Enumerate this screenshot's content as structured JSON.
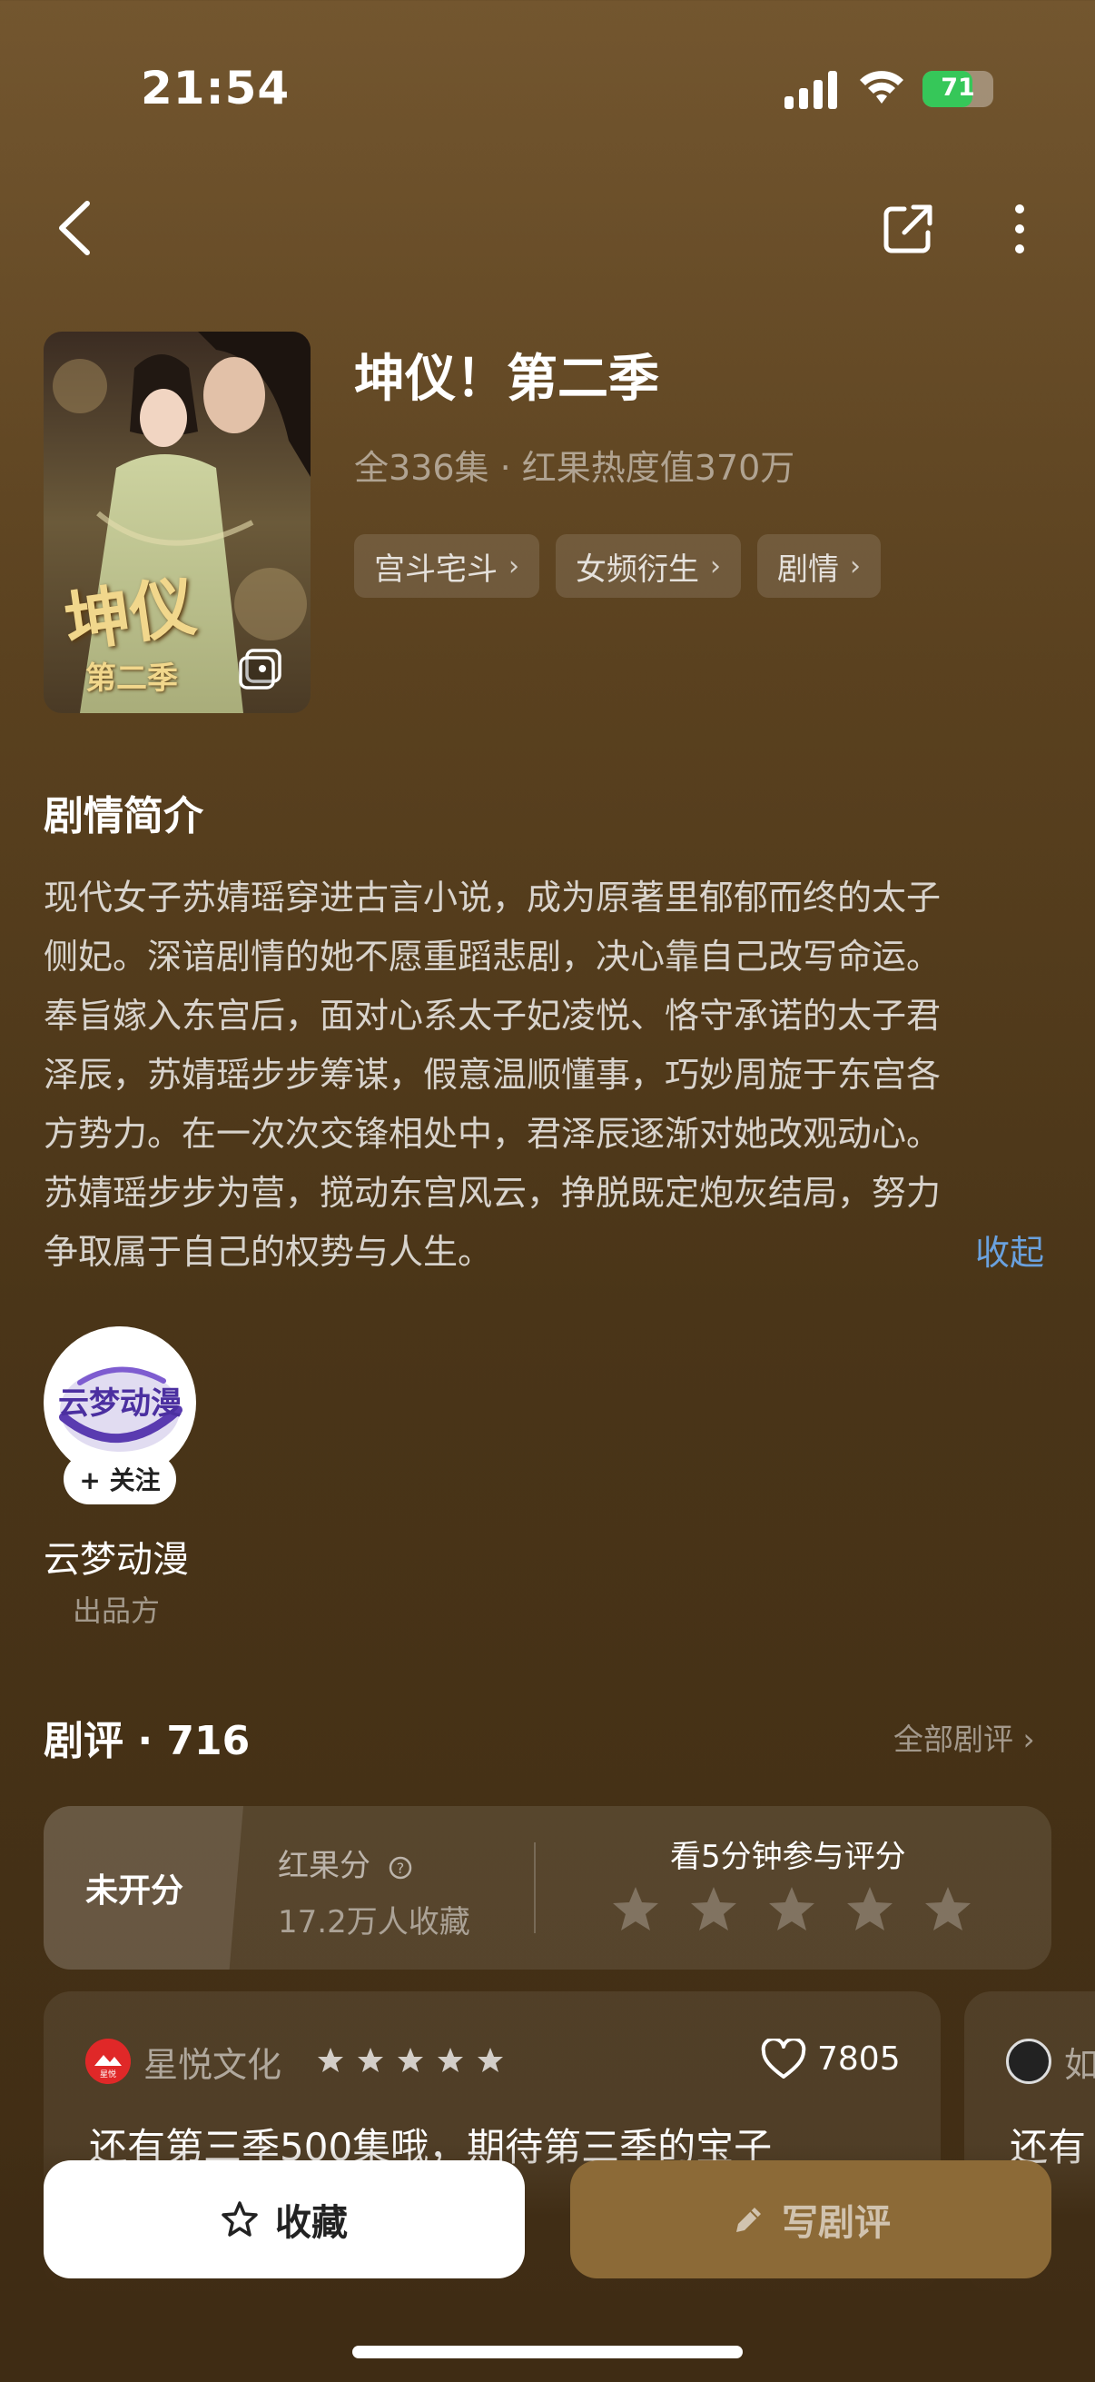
{
  "status_bar": {
    "time": "21:54",
    "battery": "71",
    "battery_level": 0.71
  },
  "show": {
    "title": "坤仪！第二季",
    "meta": "全336集 · 红果热度值370万",
    "tags": [
      "宫斗宅斗",
      "女频衍生",
      "剧情"
    ],
    "cover_title": "坤仪",
    "cover_subtitle": "第二季"
  },
  "synopsis": {
    "heading": "剧情简介",
    "lines": [
      "现代女子苏婧瑶穿进古言小说，成为原著里郁郁而终的太子",
      "侧妃。深谙剧情的她不愿重蹈悲剧，决心靠自己改写命运。",
      "奉旨嫁入东宫后，面对心系太子妃凌悦、恪守承诺的太子君",
      "泽辰，苏婧瑶步步筹谋，假意温顺懂事，巧妙周旋于东宫各",
      "方势力。在一次次交锋相处中，君泽辰逐渐对她改观动心。",
      "苏婧瑶步步为营，搅动东宫风云，挣脱既定炮灰结局，努力",
      "争取属于自己的权势与人生。"
    ],
    "collapse_label": "收起"
  },
  "producer": {
    "logo_text": "云梦动漫",
    "follow_label": "+ 关注",
    "name": "云梦动漫",
    "role": "出品方"
  },
  "reviews": {
    "heading": "剧评 · 716",
    "all_label": "全部剧评 ›",
    "rating": {
      "status": "未开分",
      "score_label": "红果分",
      "favorites": "17.2万人收藏",
      "prompt": "看5分钟参与评分"
    },
    "items": [
      {
        "author": "星悦文化",
        "avatar_text": "星悦",
        "stars": 5,
        "likes": "7805",
        "text": "还有第三季500集哦，期待第三季的宝子"
      },
      {
        "author": "如",
        "text": "还有"
      }
    ]
  },
  "actions": {
    "favorite_label": "收藏",
    "write_review_label": "写剧评"
  },
  "colors": {
    "accent_link": "#6aa1de",
    "battery_green": "#36c759",
    "write_button": "#8c6a37"
  }
}
